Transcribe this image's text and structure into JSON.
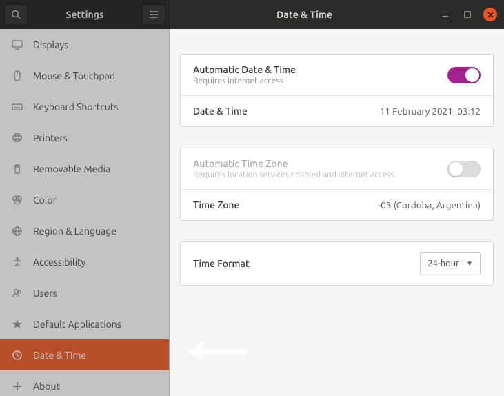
{
  "titlebar": {
    "left_title": "Settings",
    "right_title": "Date & Time"
  },
  "sidebar": {
    "items": [
      {
        "label": "Displays"
      },
      {
        "label": "Mouse & Touchpad"
      },
      {
        "label": "Keyboard Shortcuts"
      },
      {
        "label": "Printers"
      },
      {
        "label": "Removable Media"
      },
      {
        "label": "Color"
      },
      {
        "label": "Region & Language"
      },
      {
        "label": "Accessibility"
      },
      {
        "label": "Users"
      },
      {
        "label": "Default Applications"
      },
      {
        "label": "Date & Time"
      },
      {
        "label": "About"
      }
    ]
  },
  "panels": {
    "auto_dt": {
      "title": "Automatic Date & Time",
      "sub": "Requires internet access"
    },
    "dt": {
      "label": "Date & Time",
      "value": "11 February 2021, 03:12"
    },
    "auto_tz": {
      "title": "Automatic Time Zone",
      "sub": "Requires location services enabled and internet access"
    },
    "tz": {
      "label": "Time Zone",
      "value": "-03 (Cordoba, Argentina)"
    },
    "tf": {
      "label": "Time Format",
      "value": "24-hour"
    }
  }
}
